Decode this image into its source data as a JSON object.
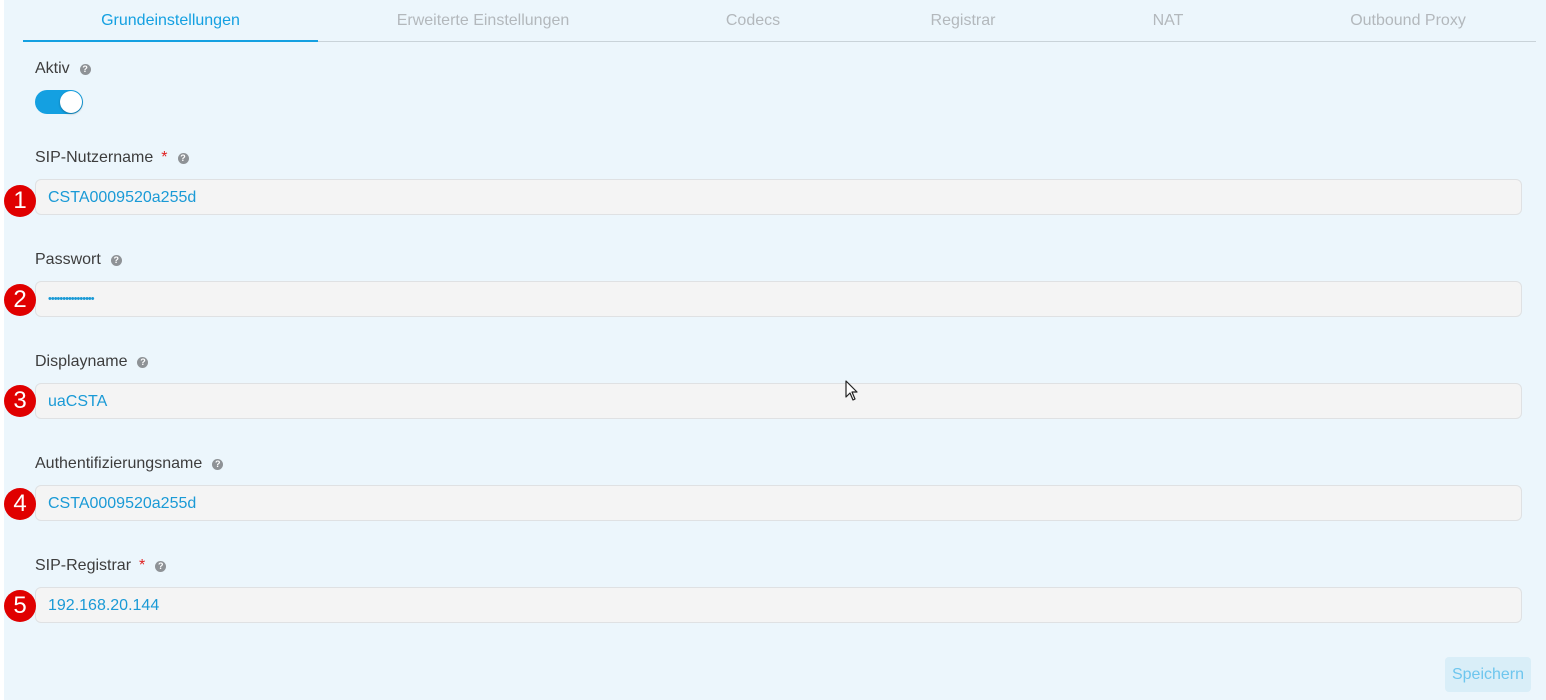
{
  "tabs": [
    {
      "label": "Grundeinstellungen",
      "active": true
    },
    {
      "label": "Erweiterte Einstellungen",
      "active": false
    },
    {
      "label": "Codecs",
      "active": false
    },
    {
      "label": "Registrar",
      "active": false
    },
    {
      "label": "NAT",
      "active": false
    },
    {
      "label": "Outbound Proxy",
      "active": false
    }
  ],
  "active_toggle": {
    "label": "Aktiv",
    "help": "?",
    "checked": true
  },
  "fields": [
    {
      "label": "SIP-Nutzername",
      "required": "*",
      "help": "?",
      "value": "CSTA0009520a255d",
      "badge": "1"
    },
    {
      "label": "Passwort",
      "help": "?",
      "value": "••••••••••••••••",
      "badge": "2"
    },
    {
      "label": "Displayname",
      "help": "?",
      "value": "uaCSTA",
      "badge": "3"
    },
    {
      "label": "Authentifizierungsname",
      "help": "?",
      "value": "CSTA0009520a255d",
      "badge": "4"
    },
    {
      "label": "SIP-Registrar",
      "required": "*",
      "help": "?",
      "value": "192.168.20.144",
      "badge": "5"
    }
  ],
  "save_label": "Speichern",
  "colors": {
    "accent": "#14a0e1",
    "panel_bg": "#ecf6fc",
    "badge": "#e00000",
    "required": "#e02020"
  },
  "icons": {
    "help": "question-circle-icon",
    "cursor": "mouse-pointer-icon"
  }
}
